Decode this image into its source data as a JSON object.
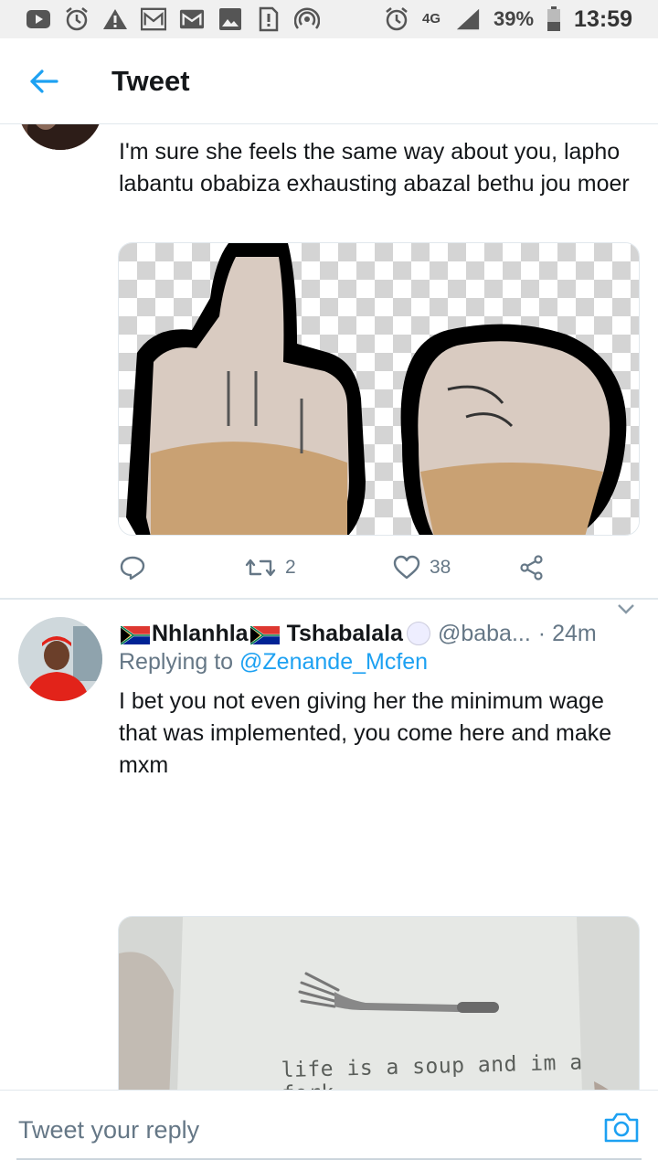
{
  "status_bar": {
    "battery": "39%",
    "time": "13:59",
    "network": "4G"
  },
  "header": {
    "title": "Tweet"
  },
  "tweet1": {
    "text": "I'm sure she feels the same way about you, lapho labantu obabiza exhausting abazal bethu jou moer",
    "retweets": "2",
    "likes": "38"
  },
  "tweet2": {
    "name_first": "Nhlanhla",
    "name_last": "Tshabalala",
    "handle": "@baba...",
    "time": "· 24m",
    "replying_prefix": "Replying to",
    "replying_to": "@Zenande_Mcfen",
    "text": "I bet you not even giving her the minimum wage that was implemented, you come here and make mxm",
    "image_caption": "life is a soup and im a fork"
  },
  "reply_bar": {
    "placeholder": "Tweet your reply"
  },
  "colors": {
    "accent": "#1da1f2",
    "secondary_text": "#657786",
    "divider": "#e1e8ed"
  }
}
